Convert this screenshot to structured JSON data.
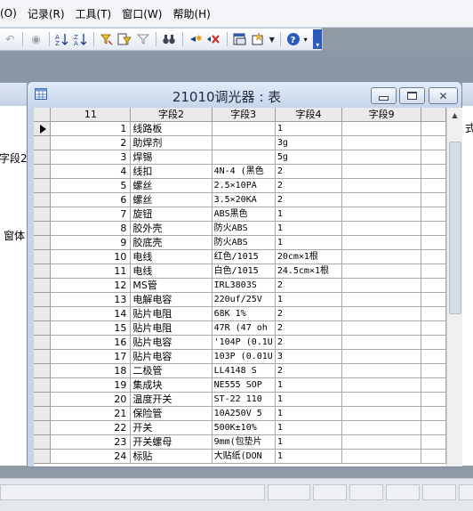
{
  "menu": [
    "(O)",
    "记录(R)",
    "工具(T)",
    "窗口(W)",
    "帮助(H)"
  ],
  "background_left": {
    "labels": [
      "字段2",
      "窗体"
    ]
  },
  "background_right": {
    "label": "式"
  },
  "window": {
    "title": "21010调光器 : 表"
  },
  "table": {
    "columns": [
      "11",
      "字段2",
      "字段3",
      "字段4",
      "字段9"
    ],
    "rows": [
      {
        "id": "1",
        "f2": "线路板",
        "f3": "",
        "f4": "1"
      },
      {
        "id": "2",
        "f2": "助焊剂",
        "f3": "",
        "f4": "3g"
      },
      {
        "id": "3",
        "f2": "焊锡",
        "f3": "",
        "f4": "5g"
      },
      {
        "id": "4",
        "f2": "线扣",
        "f3": "4N-4 (黑色",
        "f4": "2"
      },
      {
        "id": "5",
        "f2": "螺丝",
        "f3": "2.5×10PA",
        "f4": "2"
      },
      {
        "id": "6",
        "f2": "螺丝",
        "f3": "3.5×20KA",
        "f4": "2"
      },
      {
        "id": "7",
        "f2": "旋钮",
        "f3": "ABS黑色",
        "f4": "1"
      },
      {
        "id": "8",
        "f2": "胶外壳",
        "f3": "防火ABS",
        "f4": "1"
      },
      {
        "id": "9",
        "f2": "胶底壳",
        "f3": "防火ABS",
        "f4": "1"
      },
      {
        "id": "10",
        "f2": "电线",
        "f3": "红色/1015",
        "f4": "20cm×1根"
      },
      {
        "id": "11",
        "f2": "电线",
        "f3": "白色/1015",
        "f4": "24.5cm×1根"
      },
      {
        "id": "12",
        "f2": "MS管",
        "f3": "IRL3803S",
        "f4": "2"
      },
      {
        "id": "13",
        "f2": "电解电容",
        "f3": "220uf/25V",
        "f4": "1"
      },
      {
        "id": "14",
        "f2": "贴片电阻",
        "f3": "68K    1%",
        "f4": "2"
      },
      {
        "id": "15",
        "f2": "贴片电阻",
        "f3": "47R  (47 oh",
        "f4": "2"
      },
      {
        "id": "16",
        "f2": "贴片电容",
        "f3": "'104P (0.1U",
        "f4": "2"
      },
      {
        "id": "17",
        "f2": "贴片电容",
        "f3": "103P (0.01U",
        "f4": "3"
      },
      {
        "id": "18",
        "f2": "二极管",
        "f3": "LL4148   S",
        "f4": "2"
      },
      {
        "id": "19",
        "f2": "集成块",
        "f3": "NE555  SOP",
        "f4": "1"
      },
      {
        "id": "20",
        "f2": "温度开关",
        "f3": "ST-22  110",
        "f4": "1"
      },
      {
        "id": "21",
        "f2": "保险管",
        "f3": "10A250V  5",
        "f4": "1"
      },
      {
        "id": "22",
        "f2": "开关",
        "f3": "500K±10%",
        "f4": "1"
      },
      {
        "id": "23",
        "f2": "开关螺母",
        "f3": "9mm(包垫片",
        "f4": "1"
      },
      {
        "id": "24",
        "f2": "标贴",
        "f3": "大贴纸(DON",
        "f4": "1"
      }
    ]
  },
  "colors": {
    "selected_marker": "#000000",
    "delete_icon": "#d0312d",
    "help_icon": "#2c5bb8"
  },
  "toolbar_icons": [
    "undo-icon",
    "db-icon",
    "sort-ascending-icon",
    "sort-descending-icon",
    "filter-by-selection-icon",
    "filter-by-form-icon",
    "apply-filter-icon",
    "find-icon",
    "new-record-icon",
    "delete-record-icon",
    "database-window-icon",
    "new-object-icon",
    "help-icon"
  ]
}
